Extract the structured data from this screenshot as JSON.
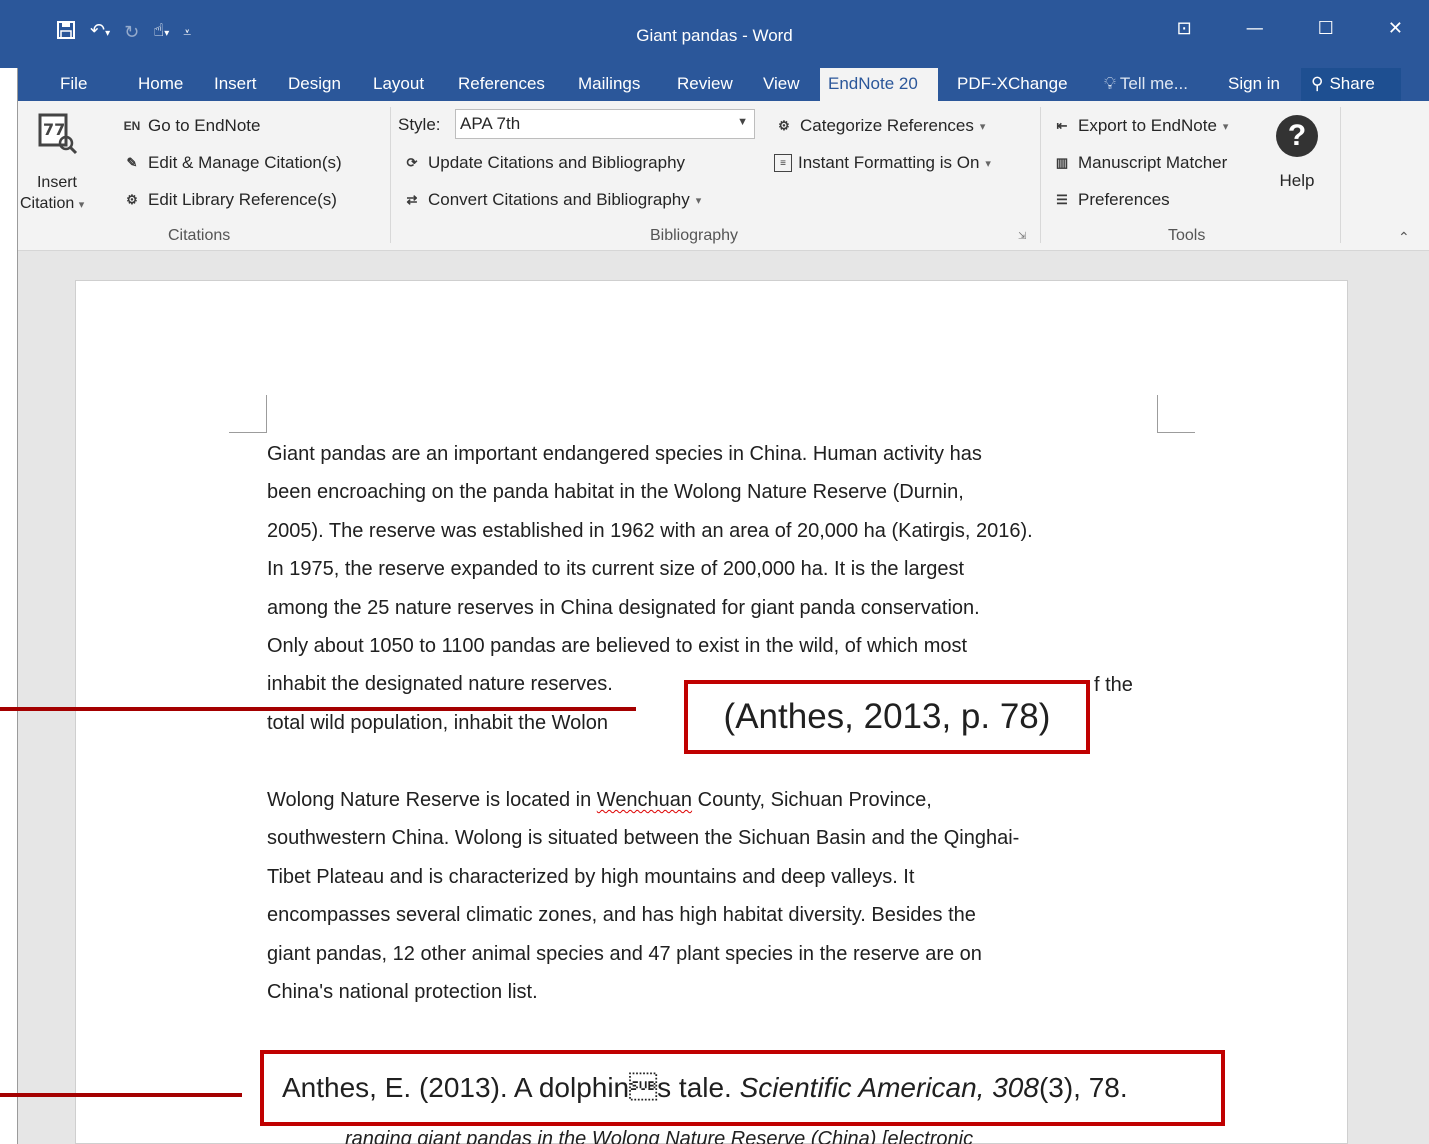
{
  "window": {
    "title": "Giant pandas - Word",
    "qat": [
      "save-icon",
      "undo-icon",
      "redo-icon",
      "touch-mode-icon",
      "customize-qat-icon"
    ],
    "controls": {
      "ribbon_display": "⊡",
      "minimize": "—",
      "maximize": "☐",
      "close": "✕"
    }
  },
  "tabs": [
    {
      "label": "File"
    },
    {
      "label": "Home"
    },
    {
      "label": "Insert"
    },
    {
      "label": "Design"
    },
    {
      "label": "Layout"
    },
    {
      "label": "References"
    },
    {
      "label": "Mailings"
    },
    {
      "label": "Review"
    },
    {
      "label": "View"
    },
    {
      "label": "EndNote 20",
      "active": true
    },
    {
      "label": "PDF-XChange"
    },
    {
      "label": "Tell me..."
    },
    {
      "label": "Sign in"
    },
    {
      "label": "Share"
    }
  ],
  "ribbon": {
    "citations": {
      "insert_citation_line1": "Insert",
      "insert_citation_line2": "Citation",
      "go_to_endnote": "Go to EndNote",
      "edit_manage": "Edit & Manage Citation(s)",
      "edit_library": "Edit Library Reference(s)",
      "group_label": "Citations"
    },
    "bibliography": {
      "style_label": "Style:",
      "style_value": "APA 7th",
      "update": "Update Citations and Bibliography",
      "convert": "Convert Citations and Bibliography",
      "categorize": "Categorize References",
      "instant_formatting": "Instant Formatting is On",
      "group_label": "Bibliography"
    },
    "tools": {
      "export": "Export to EndNote",
      "manuscript_matcher": "Manuscript Matcher",
      "preferences": "Preferences",
      "help": "Help",
      "group_label": "Tools"
    }
  },
  "document": {
    "paragraph1": [
      "Giant pandas are an important endangered species in China.    Human activity has",
      "been encroaching on the panda habitat in the Wolong Nature Reserve (Durnin,",
      "2005). The reserve was established in 1962 with an area of 20,000 ha (Katirgis, 2016).",
      "In 1975, the reserve expanded to its current size of 200,000 ha. It is the largest",
      "among the 25 nature reserves in China designated for giant panda conservation.",
      "Only about 1050 to 1100 pandas are believed to exist in the wild, of which most",
      "inhabit the designated nature reserves.",
      "total wild population, inhabit the Wolon"
    ],
    "paragraph1_line7_tail": "f the",
    "paragraph2": [
      "Wolong Nature Reserve is located in ",
      "southwestern China. Wolong is situated between the Sichuan Basin and the Qinghai-",
      "Tibet Plateau and is characterized by high mountains and deep valleys.    It",
      "encompasses several climatic zones, and has high habitat diversity.    Besides the",
      "giant pandas, 12 other animal species and 47 plant species in the reserve are on",
      "China's national protection list."
    ],
    "paragraph2_misspelled": "Wenchuan",
    "paragraph2_line1_tail": " County, Sichuan Province,",
    "partial_line": "ranging giant pandas in the Wolong Nature Reserve (China) [electronic"
  },
  "callouts": {
    "citation": "(Anthes, 2013, p. 78)",
    "reference_plain": "Anthes, E. (2013). A dolphin\u001as tale. ",
    "reference_journal": "Scientific American, 308",
    "reference_tail": "(3), 78."
  }
}
